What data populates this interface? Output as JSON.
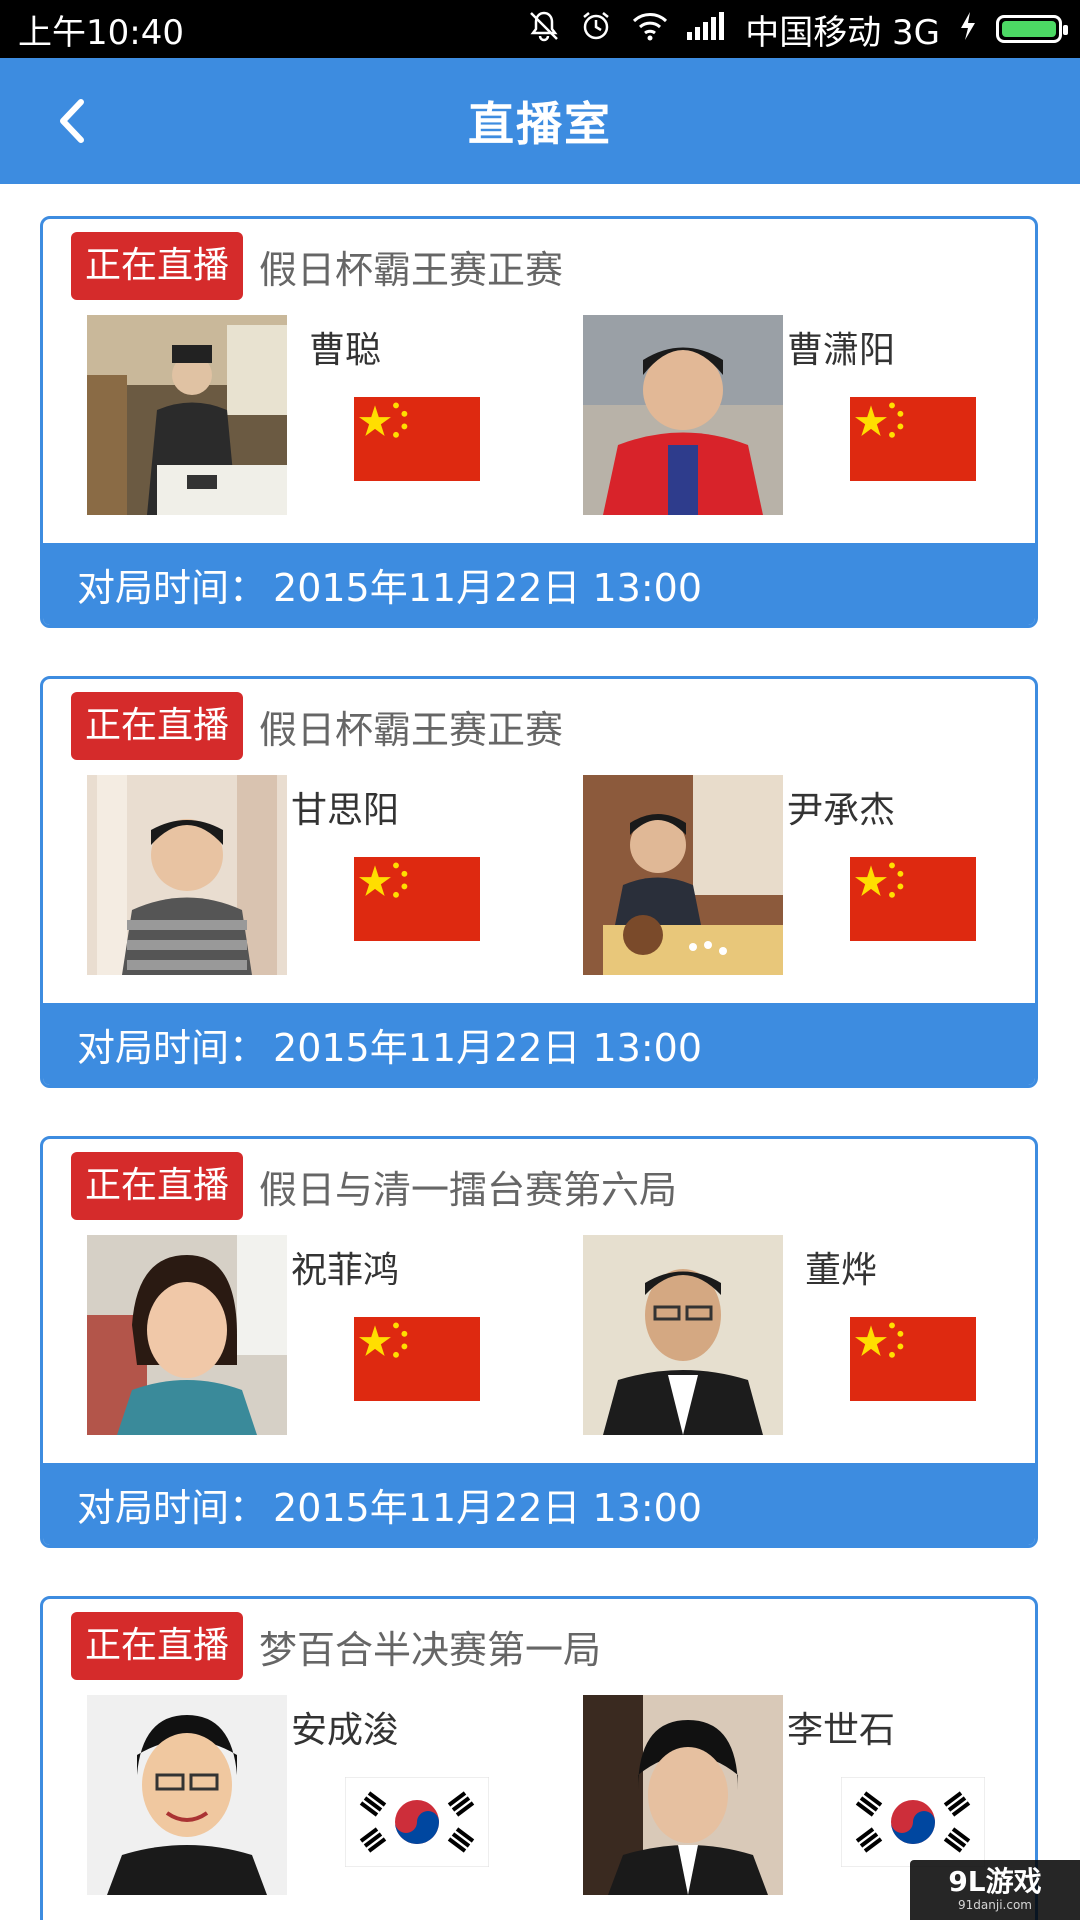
{
  "status_bar": {
    "time": "上午10:40",
    "carrier": "中国移动 3G",
    "icons": [
      "mute-icon",
      "alarm-icon",
      "wifi-icon",
      "signal-icon",
      "charging-icon",
      "battery-icon"
    ]
  },
  "header": {
    "title": "直播室",
    "back_icon": "chevron-left-icon"
  },
  "colors": {
    "accent": "#3d8ce0",
    "live_badge": "#d52b2b",
    "china_flag_red": "#de2910",
    "china_flag_star": "#ffde00"
  },
  "matches": [
    {
      "badge": "正在直播",
      "title": "假日杯霸王赛正赛",
      "player1": {
        "name": "曹聪",
        "flag": "china-flag-icon"
      },
      "player2": {
        "name": "曹潇阳",
        "flag": "china-flag-icon"
      },
      "time_label": "对局时间：",
      "time_value": "2015年11月22日  13:00"
    },
    {
      "badge": "正在直播",
      "title": "假日杯霸王赛正赛",
      "player1": {
        "name": "甘思阳",
        "flag": "china-flag-icon"
      },
      "player2": {
        "name": "尹承杰",
        "flag": "china-flag-icon"
      },
      "time_label": "对局时间：",
      "time_value": "2015年11月22日  13:00"
    },
    {
      "badge": "正在直播",
      "title": "假日与清一擂台赛第六局",
      "player1": {
        "name": "祝菲鸿",
        "flag": "china-flag-icon"
      },
      "player2": {
        "name": "董烨",
        "flag": "china-flag-icon"
      },
      "time_label": "对局时间：",
      "time_value": "2015年11月22日  13:00"
    },
    {
      "badge": "正在直播",
      "title": "梦百合半决赛第一局",
      "player1": {
        "name": "安成浚",
        "flag": "korea-flag-icon"
      },
      "player2": {
        "name": "李世石",
        "flag": "korea-flag-icon"
      },
      "time_label": "",
      "time_value": ""
    }
  ],
  "watermark": {
    "main": "9L游戏",
    "sub": "91danji.com"
  }
}
